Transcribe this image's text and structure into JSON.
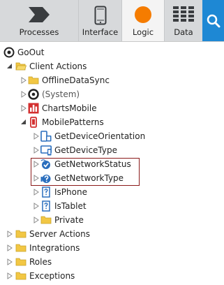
{
  "toolbar": {
    "tabs": [
      {
        "label": "Processes",
        "icon": "processes-chevron-icon"
      },
      {
        "label": "Interface",
        "icon": "mobile-phone-icon"
      },
      {
        "label": "Logic",
        "icon": "orange-circle-icon",
        "active": true
      },
      {
        "label": "Data",
        "icon": "grid-table-icon"
      }
    ],
    "search_icon": "search-icon"
  },
  "tree": {
    "root": {
      "label": "GoOut",
      "icon": "module-radio-icon"
    },
    "client_actions": {
      "label": "Client Actions",
      "icon": "folder-open-icon"
    },
    "offline_data_sync": {
      "label": "OfflineDataSync",
      "icon": "folder-icon"
    },
    "system": {
      "label": "(System)",
      "icon": "system-module-icon"
    },
    "charts_mobile": {
      "label": "ChartsMobile",
      "icon": "charts-red-icon"
    },
    "mobile_patterns": {
      "label": "MobilePatterns",
      "icon": "mobile-red-icon"
    },
    "get_device_orientation": {
      "label": "GetDeviceOrientation",
      "icon": "device-orientation-icon"
    },
    "get_device_type": {
      "label": "GetDeviceType",
      "icon": "device-type-icon"
    },
    "get_network_status": {
      "label": "GetNetworkStatus",
      "icon": "network-status-icon"
    },
    "get_network_type": {
      "label": "GetNetworkType",
      "icon": "network-type-icon"
    },
    "is_phone": {
      "label": "IsPhone",
      "icon": "question-doc-icon"
    },
    "is_tablet": {
      "label": "IsTablet",
      "icon": "question-doc-icon"
    },
    "private": {
      "label": "Private",
      "icon": "folder-icon"
    },
    "server_actions": {
      "label": "Server Actions",
      "icon": "folder-icon"
    },
    "integrations": {
      "label": "Integrations",
      "icon": "folder-icon"
    },
    "roles": {
      "label": "Roles",
      "icon": "folder-icon"
    },
    "exceptions": {
      "label": "Exceptions",
      "icon": "folder-icon"
    }
  },
  "colors": {
    "accent_orange": "#f57c00",
    "search_blue": "#1e88d4",
    "folder_yellow": "#f2c744",
    "highlight_border": "#8b1a1a",
    "icon_red": "#d32f2f",
    "icon_blue": "#2a6ebd"
  }
}
